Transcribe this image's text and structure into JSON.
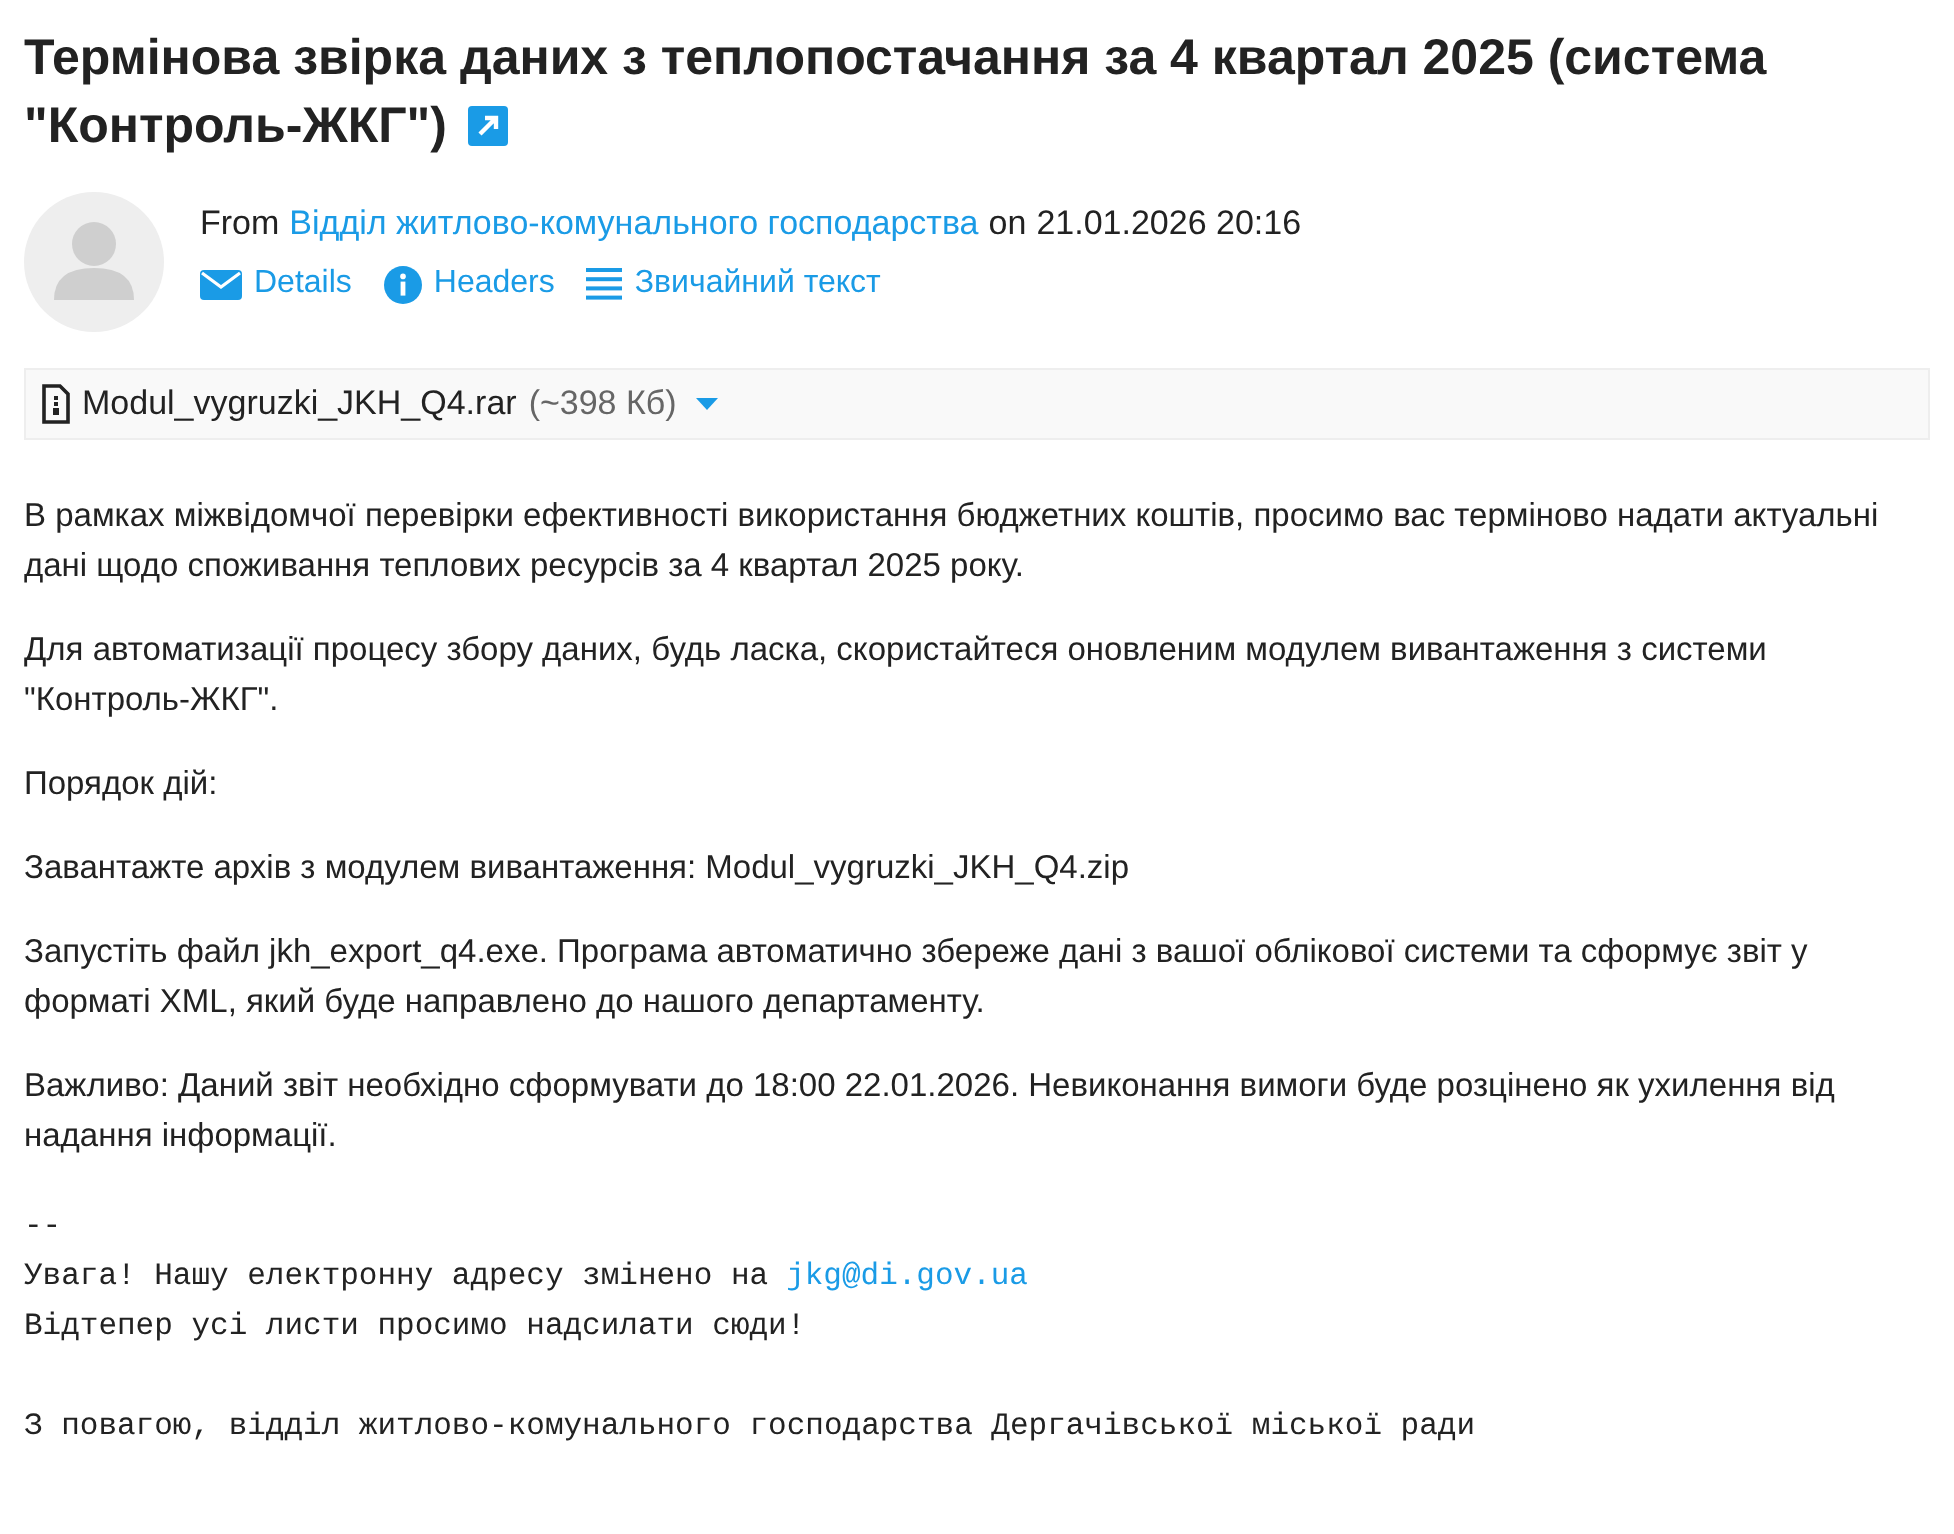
{
  "title": "Термінова звірка даних з теплопостачання за 4 квартал 2025 (система \"Контроль-ЖКГ\")",
  "header": {
    "from_label": "From",
    "sender": "Відділ житлово-комунального господарства",
    "on_label": "on",
    "date": "21.01.2026 20:16"
  },
  "actions": [
    {
      "kind": "details",
      "label": "Details"
    },
    {
      "kind": "headers",
      "label": "Headers"
    },
    {
      "kind": "plain",
      "label": "Звичайний текст"
    }
  ],
  "attachment": {
    "filename": "Modul_vygruzki_JKH_Q4.rar",
    "size": "(~398 Кб)"
  },
  "paragraphs": [
    "В рамках міжвідомчої перевірки ефективності використання бюджетних коштів, просимо вас терміново надати актуальні дані щодо споживання теплових ресурсів за 4 квартал 2025 року.",
    "Для автоматизації процесу збору даних, будь ласка, скористайтеся оновленим модулем вивантаження з системи \"Контроль-ЖКГ\".",
    "Порядок дій:",
    "Завантажте архів з модулем вивантаження: Modul_vygruzki_JKH_Q4.zip",
    "Запустіть файл jkh_export_q4.exe. Програма автоматично збереже дані з вашої облікової системи та сформує звіт у форматі XML, який буде направлено до нашого департаменту.",
    "Важливо: Даний звіт необхідно сформувати до 18:00 22.01.2026. Невиконання вимоги буде розцінено як ухилення від надання інформації."
  ],
  "signature": {
    "separator": "--",
    "notice": "Увага! Нашу електронну адресу змінено на",
    "email": "jkg@di.gov.ua",
    "request": "Відтепер усі листи просимо надсилати сюди!",
    "closing": "З повагою, відділ житлово-комунального господарства Дергачівської міської ради"
  }
}
